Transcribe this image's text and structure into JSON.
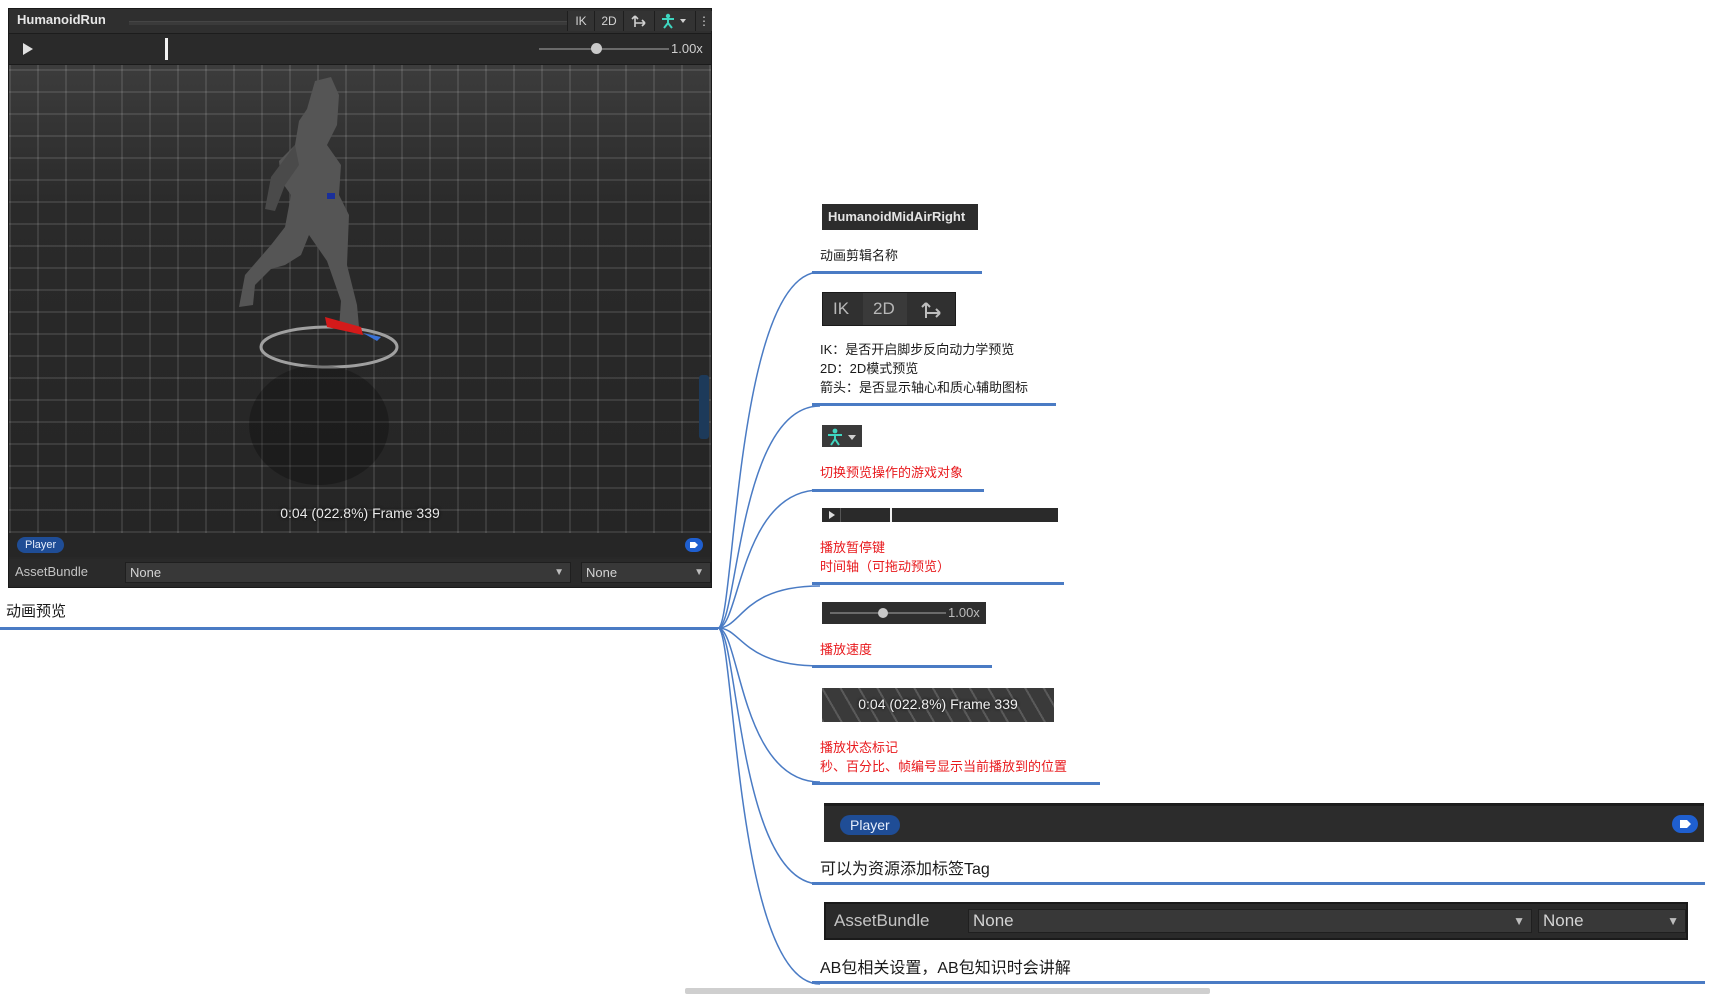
{
  "panel": {
    "clip_name": "HumanoidRun",
    "toolbar": {
      "ik": "IK",
      "two_d": "2D",
      "more": "⋮"
    },
    "speed": "1.00x",
    "status": "0:04 (022.8%) Frame 339",
    "tag": "Player",
    "assetbundle_label": "AssetBundle",
    "assetbundle_value": "None",
    "assetbundle_variant": "None"
  },
  "main_label": "动画预览",
  "annotations": {
    "clip_thumb": "HumanoidMidAirRight",
    "clip_caption": "动画剪辑名称",
    "ik_thumb": {
      "ik": "IK",
      "two_d": "2D"
    },
    "ik_lines": [
      "IK：是否开启脚步反向动力学预览",
      "2D：2D模式预览",
      "箭头：是否显示轴心和质心辅助图标"
    ],
    "avatar_caption": "切换预览操作的游戏对象",
    "play_lines": [
      "播放暂停键",
      "时间轴（可拖动预览）"
    ],
    "speed_thumb": "1.00x",
    "speed_caption": "播放速度",
    "status_thumb": "0:04 (022.8%) Frame 339",
    "status_lines": [
      "播放状态标记",
      "秒、百分比、帧编号显示当前播放到的位置"
    ],
    "tag_thumb": "Player",
    "tag_caption": "可以为资源添加标签Tag",
    "ab_thumb": {
      "label": "AssetBundle",
      "value": "None",
      "variant": "None"
    },
    "ab_caption": "AB包相关设置，AB包知识时会讲解"
  },
  "colors": {
    "accent": "#4a7bc4",
    "red_text": "#e8191d",
    "tag_blue": "#1f4d96",
    "avatar_teal": "#3fd6c0"
  }
}
